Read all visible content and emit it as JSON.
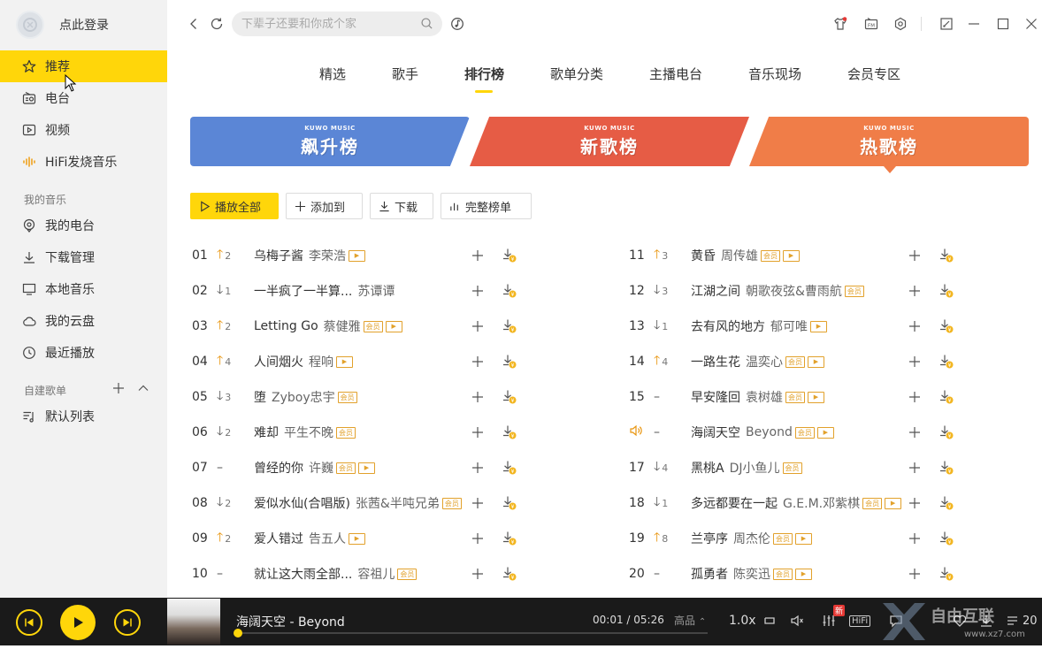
{
  "sidebar": {
    "login_text": "点此登录",
    "nav": [
      {
        "label": "推荐",
        "icon": "star-icon"
      },
      {
        "label": "电台",
        "icon": "radio-icon"
      },
      {
        "label": "视频",
        "icon": "video-icon"
      },
      {
        "label": "HiFi发烧音乐",
        "icon": "hifi-icon"
      }
    ],
    "my_music_label": "我的音乐",
    "my_music": [
      {
        "label": "我的电台",
        "icon": "podcast-icon"
      },
      {
        "label": "下载管理",
        "icon": "download-icon"
      },
      {
        "label": "本地音乐",
        "icon": "monitor-icon"
      },
      {
        "label": "我的云盘",
        "icon": "cloud-icon"
      },
      {
        "label": "最近播放",
        "icon": "clock-icon"
      }
    ],
    "custom_label": "自建歌单",
    "custom": [
      {
        "label": "默认列表",
        "icon": "playlist-icon"
      }
    ]
  },
  "search": {
    "placeholder": "下辈子还要和你成个家"
  },
  "tabs": [
    "精选",
    "歌手",
    "排行榜",
    "歌单分类",
    "主播电台",
    "音乐现场",
    "会员专区"
  ],
  "active_tab": "排行榜",
  "banners": [
    {
      "brand": "KUWO MUSIC",
      "name": "飙升榜",
      "color": "#5b86d6"
    },
    {
      "brand": "KUWO MUSIC",
      "name": "新歌榜",
      "color": "#e65c45"
    },
    {
      "brand": "KUWO MUSIC",
      "name": "热歌榜",
      "color": "#f07d48"
    }
  ],
  "actions": {
    "play_all": "播放全部",
    "add_to": "添加到",
    "download": "下载",
    "full_list": "完整榜单"
  },
  "badges": {
    "vip": "会员",
    "mv": "▶"
  },
  "songs": [
    {
      "rank": "01",
      "trend": "up",
      "change": "2",
      "title": "乌梅子酱",
      "artist": "李荣浩",
      "vip": false,
      "mv": true
    },
    {
      "rank": "02",
      "trend": "down",
      "change": "1",
      "title": "一半疯了一半算...",
      "artist": "苏谭谭",
      "vip": false,
      "mv": false
    },
    {
      "rank": "03",
      "trend": "up",
      "change": "2",
      "title": "Letting Go",
      "artist": "蔡健雅",
      "vip": true,
      "mv": true
    },
    {
      "rank": "04",
      "trend": "up",
      "change": "4",
      "title": "人间烟火",
      "artist": "程响",
      "vip": false,
      "mv": true
    },
    {
      "rank": "05",
      "trend": "down",
      "change": "3",
      "title": "堕",
      "artist": "Zyboy忠宇",
      "vip": true,
      "mv": false
    },
    {
      "rank": "06",
      "trend": "down",
      "change": "2",
      "title": "难却",
      "artist": "平生不晚",
      "vip": true,
      "mv": false
    },
    {
      "rank": "07",
      "trend": "same",
      "change": "",
      "title": "曾经的你",
      "artist": "许巍",
      "vip": true,
      "mv": true
    },
    {
      "rank": "08",
      "trend": "down",
      "change": "2",
      "title": "爱似水仙(合唱版)",
      "artist": "张茜&半吨兄弟",
      "vip": true,
      "mv": false
    },
    {
      "rank": "09",
      "trend": "up",
      "change": "2",
      "title": "爱人错过",
      "artist": "告五人",
      "vip": false,
      "mv": true
    },
    {
      "rank": "10",
      "trend": "same",
      "change": "",
      "title": "就让这大雨全部...",
      "artist": "容祖儿",
      "vip": true,
      "mv": false
    },
    {
      "rank": "11",
      "trend": "up",
      "change": "3",
      "title": "黄昏",
      "artist": "周传雄",
      "vip": true,
      "mv": true
    },
    {
      "rank": "12",
      "trend": "down",
      "change": "3",
      "title": "江湖之间",
      "artist": "朝歌夜弦&曹雨航",
      "vip": true,
      "mv": false
    },
    {
      "rank": "13",
      "trend": "down",
      "change": "1",
      "title": "去有风的地方",
      "artist": "郁可唯",
      "vip": false,
      "mv": true
    },
    {
      "rank": "14",
      "trend": "up",
      "change": "4",
      "title": "一路生花",
      "artist": "温奕心",
      "vip": true,
      "mv": true
    },
    {
      "rank": "15",
      "trend": "same",
      "change": "",
      "title": "早安隆回",
      "artist": "袁树雄",
      "vip": true,
      "mv": true
    },
    {
      "rank": "16",
      "trend": "playing",
      "change": "",
      "title": "海阔天空",
      "artist": "Beyond",
      "vip": true,
      "mv": true
    },
    {
      "rank": "17",
      "trend": "down",
      "change": "4",
      "title": "黑桃A",
      "artist": "DJ小鱼儿",
      "vip": true,
      "mv": false
    },
    {
      "rank": "18",
      "trend": "down",
      "change": "1",
      "title": "多远都要在一起",
      "artist": "G.E.M.邓紫棋",
      "vip": true,
      "mv": true
    },
    {
      "rank": "19",
      "trend": "up",
      "change": "8",
      "title": "兰亭序",
      "artist": "周杰伦",
      "vip": true,
      "mv": true
    },
    {
      "rank": "20",
      "trend": "same",
      "change": "",
      "title": "孤勇者",
      "artist": "陈奕迅",
      "vip": true,
      "mv": true
    }
  ],
  "player": {
    "now_playing": "海阔天空 - Beyond",
    "time": "00:01 / 05:26",
    "quality": "高品",
    "speed": "1.0x",
    "progress": 0.003,
    "new_badge": "新",
    "hifi_label": "HiFi",
    "count": "20"
  }
}
